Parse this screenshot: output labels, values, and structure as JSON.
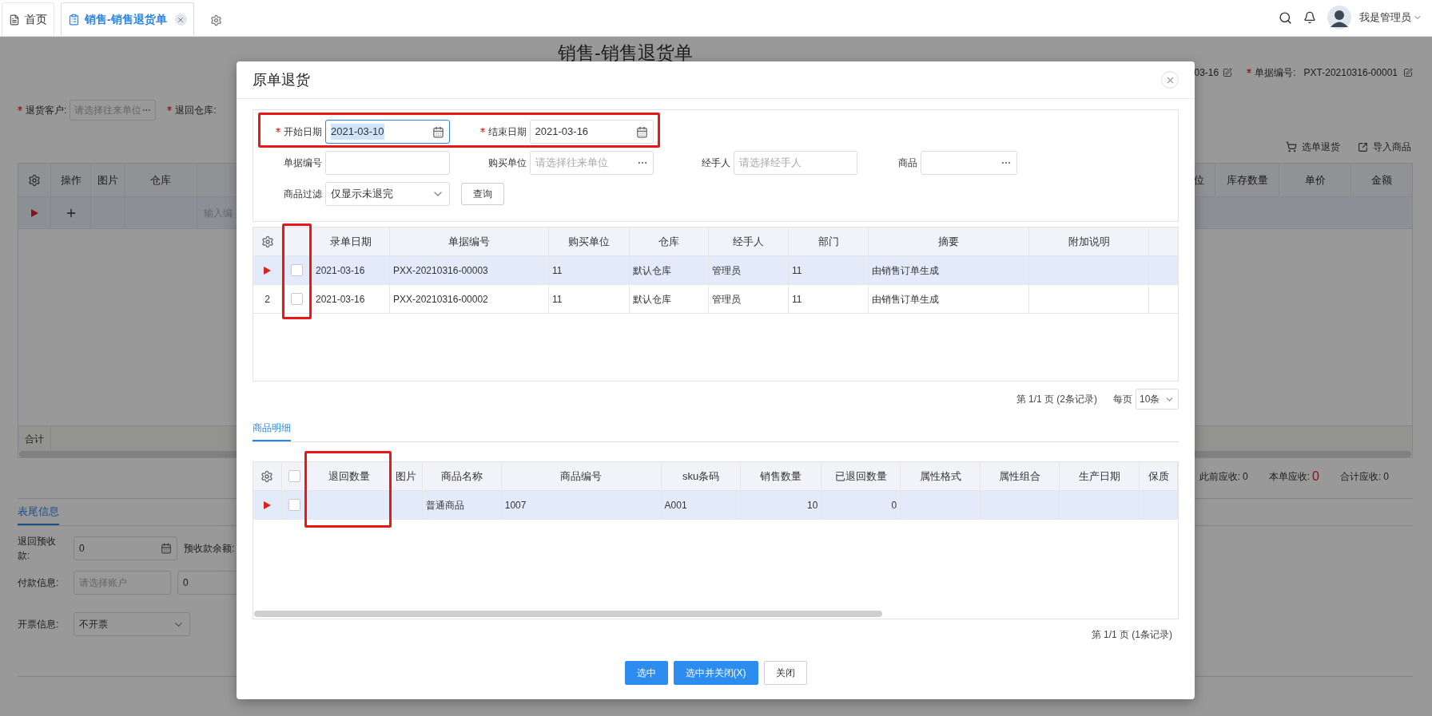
{
  "topbar": {
    "tabs": [
      {
        "label": "首页",
        "selected": false,
        "closable": false
      },
      {
        "label": "销售-销售退货单",
        "selected": true,
        "closable": true
      }
    ],
    "user": "我是管理员"
  },
  "page": {
    "title": "销售-销售退货单",
    "date_tail": "03-16",
    "doc_no": {
      "label": "单据编号:",
      "value": "PXT-20210316-00001",
      "required": true
    },
    "customer": {
      "label": "退货客户:",
      "placeholder": "请选择往来单位",
      "required": true
    },
    "warehouse": {
      "label": "退回仓库:",
      "required": true
    },
    "actions": [
      {
        "kind": "cart",
        "label": "选单退货"
      },
      {
        "kind": "import",
        "label": "导入商品"
      }
    ],
    "table": {
      "left_columns": [
        "操作",
        "图片",
        "仓库"
      ],
      "right_columns": [
        "位",
        "库存数量",
        "单价",
        "金额"
      ],
      "row_hint": "输入编",
      "footer": "合计"
    },
    "totals": [
      {
        "label": "此前应收:",
        "value": "0",
        "highlight": false
      },
      {
        "label": "本单应收:",
        "value": "0",
        "highlight": true
      },
      {
        "label": "合计应收:",
        "value": "0",
        "highlight": false
      }
    ],
    "footer_tab": "表尾信息",
    "footer_fields": [
      {
        "label": "退回预收款:",
        "inputs": [
          {
            "kind": "number",
            "value": "0"
          }
        ],
        "extra_label": "预收款余额:"
      },
      {
        "label": "付款信息:",
        "inputs": [
          {
            "kind": "picker",
            "placeholder": "请选择账户"
          },
          {
            "kind": "text",
            "value": "0"
          }
        ]
      },
      {
        "label": "开票信息:",
        "inputs": [
          {
            "kind": "select",
            "value": "不开票"
          }
        ]
      }
    ]
  },
  "modal": {
    "title": "原单退货",
    "filters": [
      [
        {
          "label": "开始日期",
          "kind": "date",
          "value": "2021-03-10",
          "required": true,
          "focused": true
        },
        {
          "label": "结束日期",
          "kind": "date",
          "value": "2021-03-16",
          "required": true,
          "focused": false
        }
      ],
      [
        {
          "label": "单据编号",
          "kind": "text",
          "focused": false
        },
        {
          "label": "购买单位",
          "kind": "picker",
          "placeholder": "请选择往来单位",
          "focused": false
        },
        {
          "label": "经手人",
          "kind": "text",
          "placeholder": "请选择经手人",
          "focused": false
        },
        {
          "label": "商品",
          "kind": "picker",
          "focused": false
        }
      ],
      [
        {
          "label": "商品过滤",
          "kind": "select",
          "value": "仅显示未退完",
          "focused": false
        }
      ]
    ],
    "query_button": "查询",
    "orders": {
      "columns": [
        "录单日期",
        "单据编号",
        "购买单位",
        "仓库",
        "经手人",
        "部门",
        "摘要",
        "附加说明"
      ],
      "rows": [
        {
          "current": true,
          "checked": false,
          "cells": [
            "2021-03-16",
            "PXX-20210316-00003",
            "11",
            "默认仓库",
            "管理员",
            "11",
            "由销售订单生成",
            null
          ]
        },
        {
          "current": false,
          "index": "2",
          "checked": false,
          "cells": [
            "2021-03-16",
            "PXX-20210316-00002",
            "11",
            "默认仓库",
            "管理员",
            "11",
            "由销售订单生成",
            null
          ]
        }
      ],
      "pager": "第 1/1 页 (2条记录)",
      "page_size_label": "每页",
      "page_size": "10条"
    },
    "detail_tab": "商品明细",
    "items": {
      "select_all": {
        "checked": false
      },
      "columns": [
        "退回数量",
        "图片",
        "商品名称",
        "商品编号",
        "sku条码",
        "销售数量",
        "已退回数量",
        "属性格式",
        "属性组合",
        "生产日期",
        "保质"
      ],
      "rows": [
        {
          "current": true,
          "checked": false,
          "cells": [
            null,
            null,
            "普通商品",
            "1007",
            "A001",
            "10",
            "0",
            null,
            null,
            null,
            null
          ]
        }
      ],
      "pager": "第 1/1 页 (1条记录)"
    },
    "buttons": [
      {
        "label": "选中",
        "primary": true
      },
      {
        "label": "选中并关闭(X)",
        "primary": true
      },
      {
        "label": "关闭",
        "primary": false
      }
    ]
  }
}
